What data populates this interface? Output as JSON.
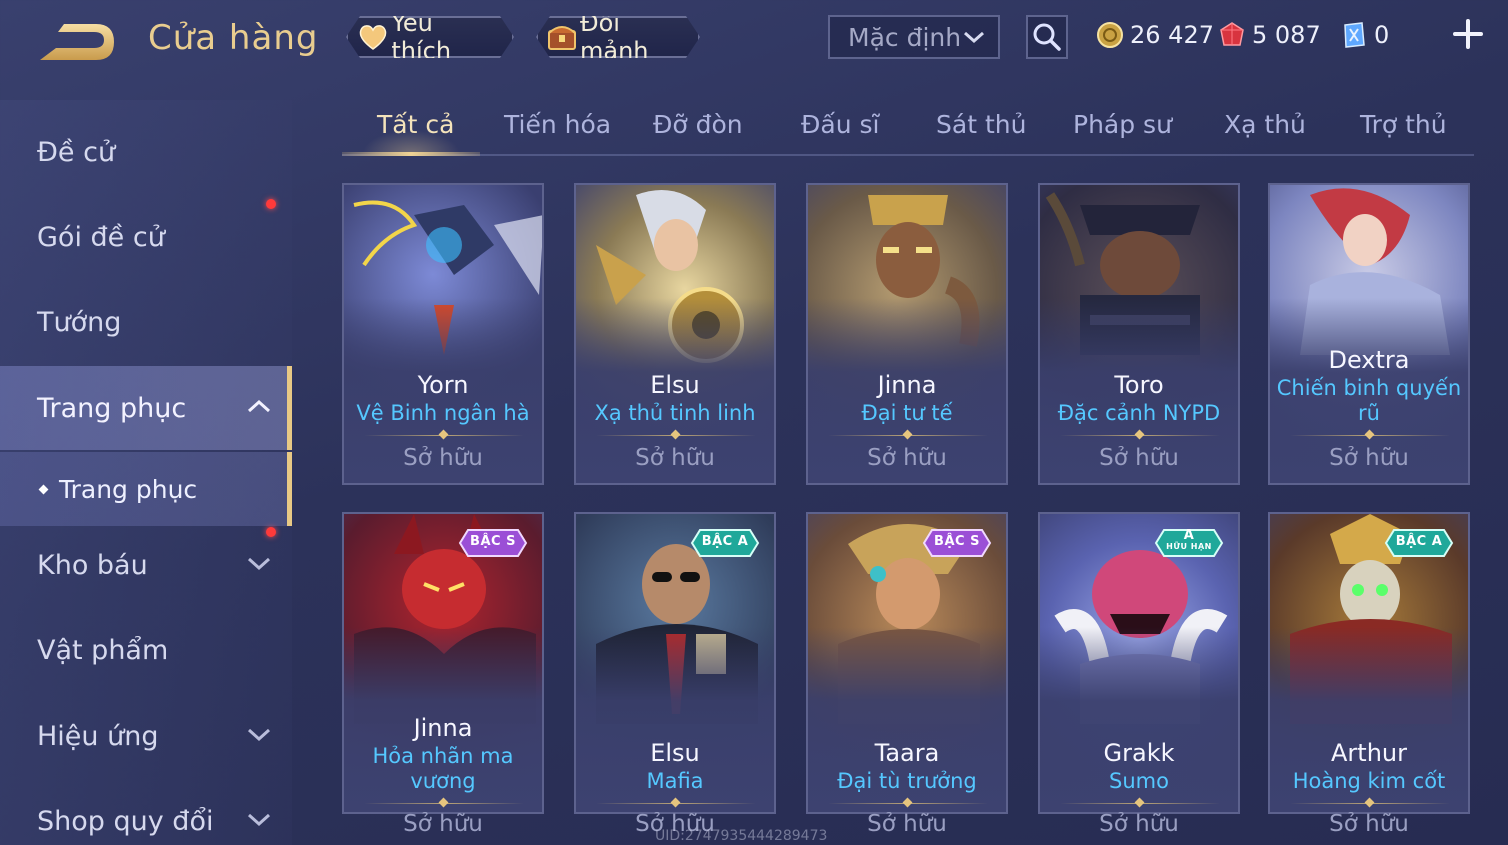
{
  "header": {
    "title": "Cửa hàng",
    "favorite_label": "Yêu thích",
    "exchange_label": "Đổi mảnh",
    "sort_value": "Mặc định",
    "currencies": [
      {
        "icon": "gold-coin-icon",
        "value": "26 427"
      },
      {
        "icon": "ruby-icon",
        "value": "5 087"
      },
      {
        "icon": "voucher-icon",
        "value": "0"
      }
    ]
  },
  "sidebar": {
    "items": [
      {
        "label": "Đề cử"
      },
      {
        "label": "Gói đề cử"
      },
      {
        "label": "Tướng"
      },
      {
        "label": "Trang phục"
      },
      {
        "label": "Kho báu"
      },
      {
        "label": "Vật phẩm"
      },
      {
        "label": "Hiệu ứng"
      },
      {
        "label": "Shop quy đổi"
      }
    ],
    "sub_item": "Trang phục"
  },
  "tabs": [
    "Tất cả",
    "Tiến hóa",
    "Đỡ đòn",
    "Đấu sĩ",
    "Sát thủ",
    "Pháp sư",
    "Xạ thủ",
    "Trợ thủ"
  ],
  "cards": [
    {
      "hero": "Yorn",
      "skin": "Vệ Binh ngân hà",
      "status": "Sở hữu"
    },
    {
      "hero": "Elsu",
      "skin": "Xạ thủ tinh linh",
      "status": "Sở hữu"
    },
    {
      "hero": "Jinna",
      "skin": "Đại tư tế",
      "status": "Sở hữu"
    },
    {
      "hero": "Toro",
      "skin": "Đặc cảnh NYPD",
      "status": "Sở hữu"
    },
    {
      "hero": "Dextra",
      "skin": "Chiến binh quyến rũ",
      "status": "Sở hữu"
    },
    {
      "hero": "Jinna",
      "skin": "Hỏa nhãn ma vương",
      "status": "Sở hữu",
      "badge": "BẬC S"
    },
    {
      "hero": "Elsu",
      "skin": "Mafia",
      "status": "Sở hữu",
      "badge": "BẬC A"
    },
    {
      "hero": "Taara",
      "skin": "Đại tù trưởng",
      "status": "Sở hữu",
      "badge": "BẬC S"
    },
    {
      "hero": "Grakk",
      "skin": "Sumo",
      "status": "Sở hữu",
      "badge": "A",
      "badge_sub": "HỮU HẠN"
    },
    {
      "hero": "Arthur",
      "skin": "Hoàng kim cốt",
      "status": "Sở hữu",
      "badge": "BẬC A"
    }
  ],
  "uid": "UID:2747935444289473",
  "colors": {
    "accent_gold": "#e9cd8f",
    "skin_name_blue": "#55c8ff",
    "notification_red": "#ff3a3a",
    "badge_s_purple": "#9b4fd6",
    "badge_a_teal": "#1fa89a"
  }
}
